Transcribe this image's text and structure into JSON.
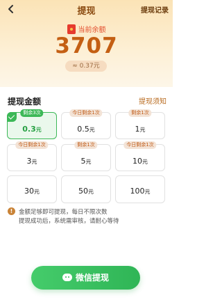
{
  "header": {
    "title": "提现",
    "record_label": "提现记录"
  },
  "balance": {
    "label": "当前余额",
    "amount": "3707",
    "approx": "≈ 0.37元"
  },
  "section": {
    "title": "提现金额",
    "notice_link": "提现须知"
  },
  "options": [
    {
      "badge": "剩余3次",
      "value": "0.3",
      "unit": "元",
      "selected": true
    },
    {
      "badge": "今日剩余1次",
      "value": "0.5",
      "unit": "元",
      "selected": false
    },
    {
      "badge": "剩余1次",
      "value": "1",
      "unit": "元",
      "selected": false
    },
    {
      "badge": "今日剩余1次",
      "value": "3",
      "unit": "元",
      "selected": false
    },
    {
      "badge": "剩余1次",
      "value": "5",
      "unit": "元",
      "selected": false
    },
    {
      "badge": "今日剩余1次",
      "value": "10",
      "unit": "元",
      "selected": false
    },
    {
      "badge": "",
      "value": "30",
      "unit": "元",
      "selected": false
    },
    {
      "badge": "",
      "value": "50",
      "unit": "元",
      "selected": false
    },
    {
      "badge": "",
      "value": "100",
      "unit": "元",
      "selected": false
    }
  ],
  "info": {
    "icon": "!",
    "line1": "金额足够即可提现，每日不限次数",
    "line2": "提现成功后，系统需审核，请耐心等待"
  },
  "action": {
    "withdraw_label": "微信提现"
  },
  "colors": {
    "accent_green": "#3cb857",
    "amount_orange": "#c45f13"
  }
}
